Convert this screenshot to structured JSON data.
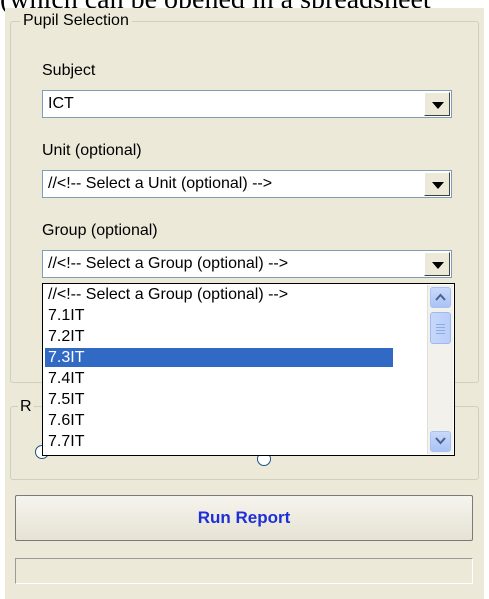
{
  "top_text": "(which can be opened in a spreadsheet",
  "pupil_selection": {
    "title": "Pupil Selection",
    "subject_label": "Subject",
    "subject_value": "ICT",
    "unit_label": "Unit (optional)",
    "unit_value": "//<!-- Select a Unit (optional) -->",
    "group_label": "Group (optional)",
    "group_value": "//<!-- Select a Group (optional) -->"
  },
  "group_dropdown": {
    "items": [
      "//<!-- Select a Group (optional) -->",
      "7.1IT",
      "7.2IT",
      "7.3IT",
      "7.4IT",
      "7.5IT",
      "7.6IT",
      "7.7IT"
    ],
    "selected_index": 3,
    "scroll_fraction": 0.0
  },
  "lower_group": {
    "title_partial": "R"
  },
  "run_button_label": "Run Report",
  "colors": {
    "selection": "#316ac5",
    "button_text": "#1d2fd5",
    "panel": "#ece9d8"
  }
}
